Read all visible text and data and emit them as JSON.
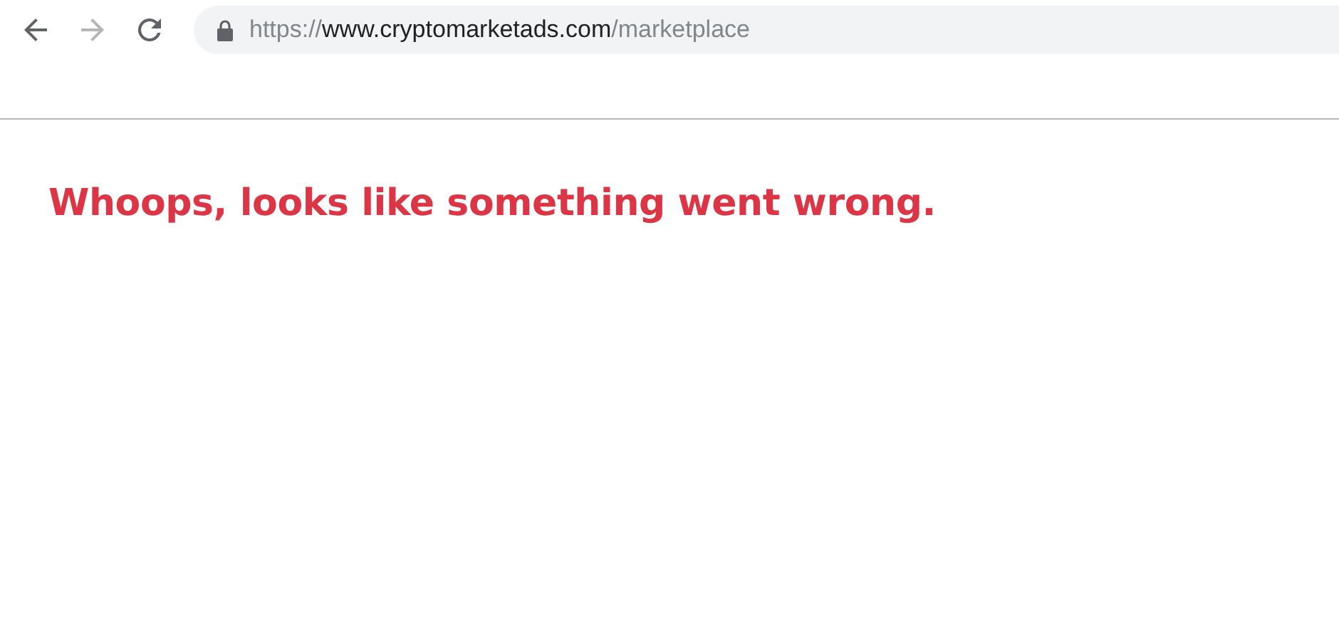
{
  "browser": {
    "nav_buttons": [
      {
        "kind": "back",
        "disabled": false
      },
      {
        "kind": "forward",
        "disabled": true
      },
      {
        "kind": "reload",
        "disabled": false
      }
    ],
    "address_bar": {
      "secure": true,
      "scheme": "https://",
      "host": "www.cryptomarketads.com",
      "path": "/marketplace"
    }
  },
  "page": {
    "error_heading": "Whoops, looks like something went wrong."
  }
}
